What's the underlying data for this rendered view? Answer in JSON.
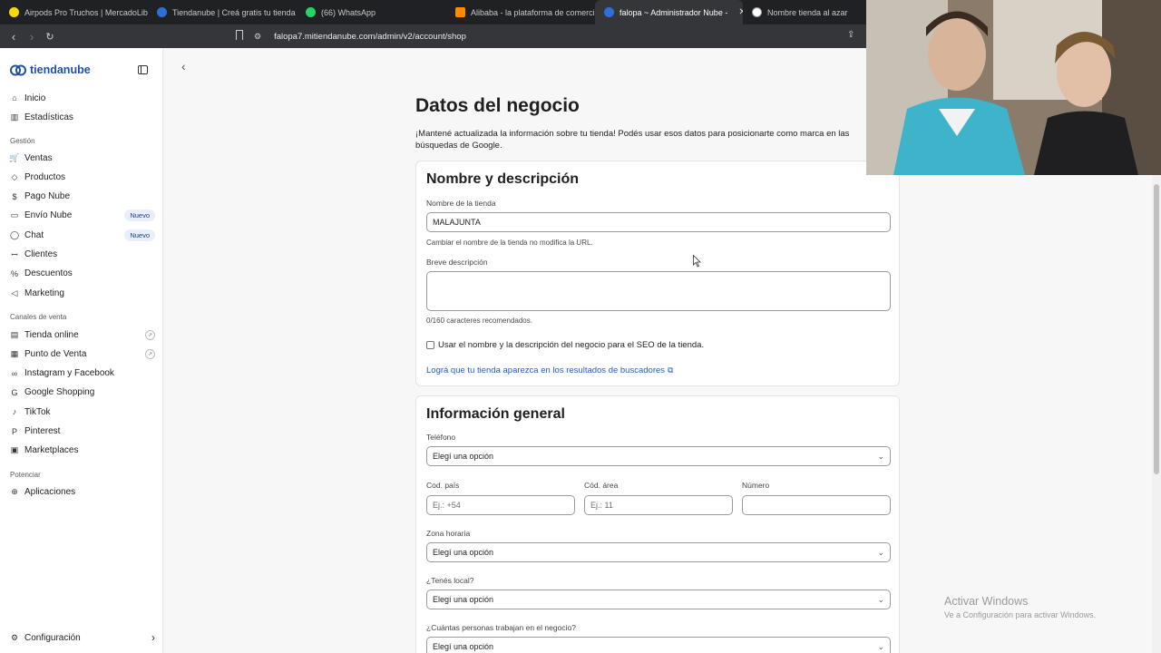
{
  "browser": {
    "tabs": [
      {
        "title": "Airpods Pro Truchos | MercadoLibre",
        "color": "#f5d90a"
      },
      {
        "title": "Tiendanube | Creá gratis tu tienda on",
        "color": "#2f6fd6"
      },
      {
        "title": "(66) WhatsApp",
        "color": "#25d366"
      },
      {
        "title": "Alibaba - la plataforma de comercio",
        "color": "#ff8a00"
      },
      {
        "title": "falopa ~ Administrador Nube -",
        "color": "#2f6fd6"
      },
      {
        "title": "Nombre tienda al azar",
        "color": "#888888"
      }
    ],
    "url": "falopa7.mitiendanube.com/admin/v2/account/shop"
  },
  "sidebar": {
    "brand": "tiendanube",
    "items_top": [
      {
        "label": "Inicio",
        "icon": "home-icon",
        "glyph": "⌂"
      },
      {
        "label": "Estadísticas",
        "icon": "chart-icon",
        "glyph": "▥"
      }
    ],
    "section_gestion": "Gestión",
    "items_gestion": [
      {
        "label": "Ventas",
        "icon": "cart-icon",
        "glyph": "🛒",
        "badge": ""
      },
      {
        "label": "Productos",
        "icon": "tag-icon",
        "glyph": "◇",
        "badge": ""
      },
      {
        "label": "Pago Nube",
        "icon": "dollar-icon",
        "glyph": "$",
        "badge": ""
      },
      {
        "label": "Envío Nube",
        "icon": "truck-icon",
        "glyph": "▭",
        "badge": "Nuevo"
      },
      {
        "label": "Chat",
        "icon": "chat-icon",
        "glyph": "◯",
        "badge": "Nuevo"
      },
      {
        "label": "Clientes",
        "icon": "users-icon",
        "glyph": "ꟷ",
        "badge": ""
      },
      {
        "label": "Descuentos",
        "icon": "discount-icon",
        "glyph": "%",
        "badge": ""
      },
      {
        "label": "Marketing",
        "icon": "megaphone-icon",
        "glyph": "◁",
        "badge": ""
      }
    ],
    "section_canales": "Canales de venta",
    "items_canales": [
      {
        "label": "Tienda online",
        "icon": "store-icon",
        "glyph": "▤",
        "ext": true
      },
      {
        "label": "Punto de Venta",
        "icon": "pos-icon",
        "glyph": "▦",
        "ext": true
      },
      {
        "label": "Instagram y Facebook",
        "icon": "infinity-icon",
        "glyph": "∞",
        "ext": false
      },
      {
        "label": "Google Shopping",
        "icon": "google-icon",
        "glyph": "G",
        "ext": false
      },
      {
        "label": "TikTok",
        "icon": "tiktok-icon",
        "glyph": "♪",
        "ext": false
      },
      {
        "label": "Pinterest",
        "icon": "pinterest-icon",
        "glyph": "P",
        "ext": false
      },
      {
        "label": "Marketplaces",
        "icon": "marketplace-icon",
        "glyph": "▣",
        "ext": false
      }
    ],
    "section_potenciar": "Potenciar",
    "items_potenciar": [
      {
        "label": "Aplicaciones",
        "icon": "apps-icon",
        "glyph": "⊕"
      }
    ],
    "config_label": "Configuración"
  },
  "main": {
    "title": "Datos del negocio",
    "description": "¡Mantené actualizada la información sobre tu tienda! Podés usar esos datos para posicionarte como marca en las búsquedas de Google.",
    "card1": {
      "title": "Nombre y descripción",
      "name_label": "Nombre de la tienda",
      "name_value": "MALAJUNTA",
      "name_helper": "Cambiar el nombre de la tienda no modifica la URL.",
      "desc_label": "Breve descripción",
      "desc_helper": "0/160 caracteres recomendados.",
      "seo_checkbox": "Usar el nombre y la descripción del negocio para el SEO de la tienda.",
      "seo_link": "Lográ que tu tienda aparezca en los resultados de buscadores"
    },
    "card2": {
      "title": "Información general",
      "phone_label": "Teléfono",
      "phone_select": "Elegí una opción",
      "country_label": "Cod. país",
      "country_placeholder": "Ej.: +54",
      "area_label": "Cód. área",
      "area_placeholder": "Ej.: 11",
      "number_label": "Número",
      "timezone_label": "Zona horaria",
      "timezone_select": "Elegí una opción",
      "local_label": "¿Tenés local?",
      "local_select": "Elegí una opción",
      "people_label": "¿Cuántas personas trabajan en el negocio?",
      "people_select": "Elegí una opción"
    }
  },
  "watermark": {
    "title": "Activar Windows",
    "subtitle": "Ve a Configuración para activar Windows."
  }
}
